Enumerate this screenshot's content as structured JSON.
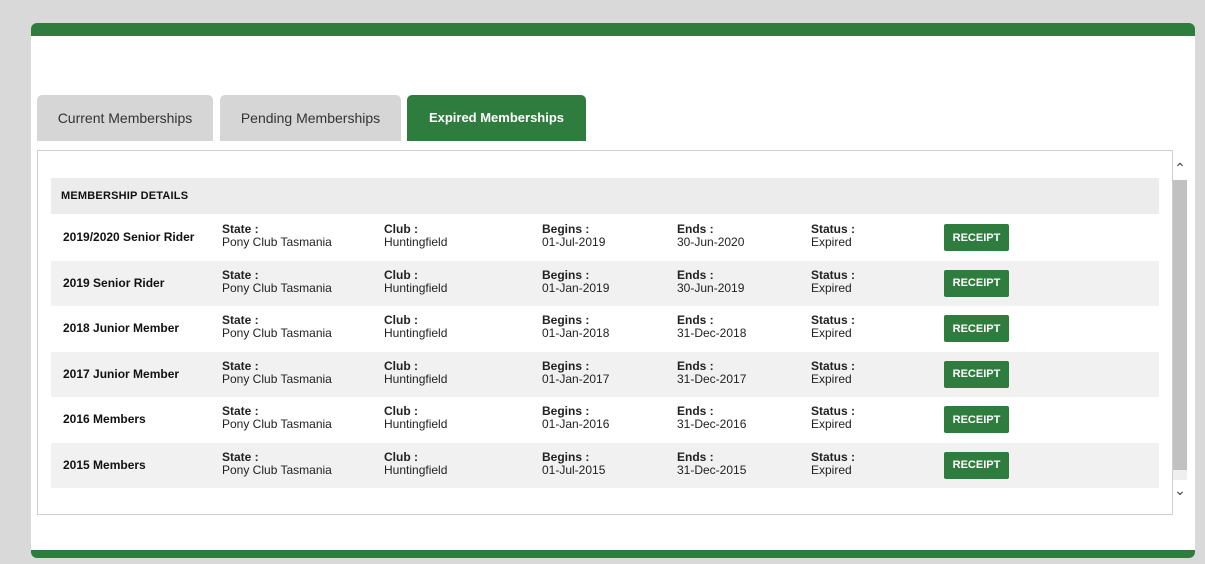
{
  "tabs": [
    {
      "label": "Current Memberships"
    },
    {
      "label": "Pending Memberships"
    },
    {
      "label": "Expired Memberships"
    }
  ],
  "header": {
    "title": "MEMBERSHIP DETAILS"
  },
  "labels": {
    "state": "State :",
    "club": "Club :",
    "begins": "Begins :",
    "ends": "Ends :",
    "status": "Status :",
    "receipt": "RECEIPT"
  },
  "memberships": [
    {
      "name": "2019/2020 Senior Rider",
      "state": "Pony Club Tasmania",
      "club": "Huntingfield",
      "begins": "01-Jul-2019",
      "ends": "30-Jun-2020",
      "status": "Expired"
    },
    {
      "name": "2019 Senior Rider",
      "state": "Pony Club Tasmania",
      "club": "Huntingfield",
      "begins": "01-Jan-2019",
      "ends": "30-Jun-2019",
      "status": "Expired"
    },
    {
      "name": "2018 Junior Member",
      "state": "Pony Club Tasmania",
      "club": "Huntingfield",
      "begins": "01-Jan-2018",
      "ends": "31-Dec-2018",
      "status": "Expired"
    },
    {
      "name": "2017 Junior Member",
      "state": "Pony Club Tasmania",
      "club": "Huntingfield",
      "begins": "01-Jan-2017",
      "ends": "31-Dec-2017",
      "status": "Expired"
    },
    {
      "name": "2016 Members",
      "state": "Pony Club Tasmania",
      "club": "Huntingfield",
      "begins": "01-Jan-2016",
      "ends": "31-Dec-2016",
      "status": "Expired"
    },
    {
      "name": "2015 Members",
      "state": "Pony Club Tasmania",
      "club": "Huntingfield",
      "begins": "01-Jul-2015",
      "ends": "31-Dec-2015",
      "status": "Expired"
    }
  ],
  "colors": {
    "accent": "#2e7d3f",
    "tab_inactive": "#d6d6d6",
    "row_alt": "#f1f1f1"
  }
}
